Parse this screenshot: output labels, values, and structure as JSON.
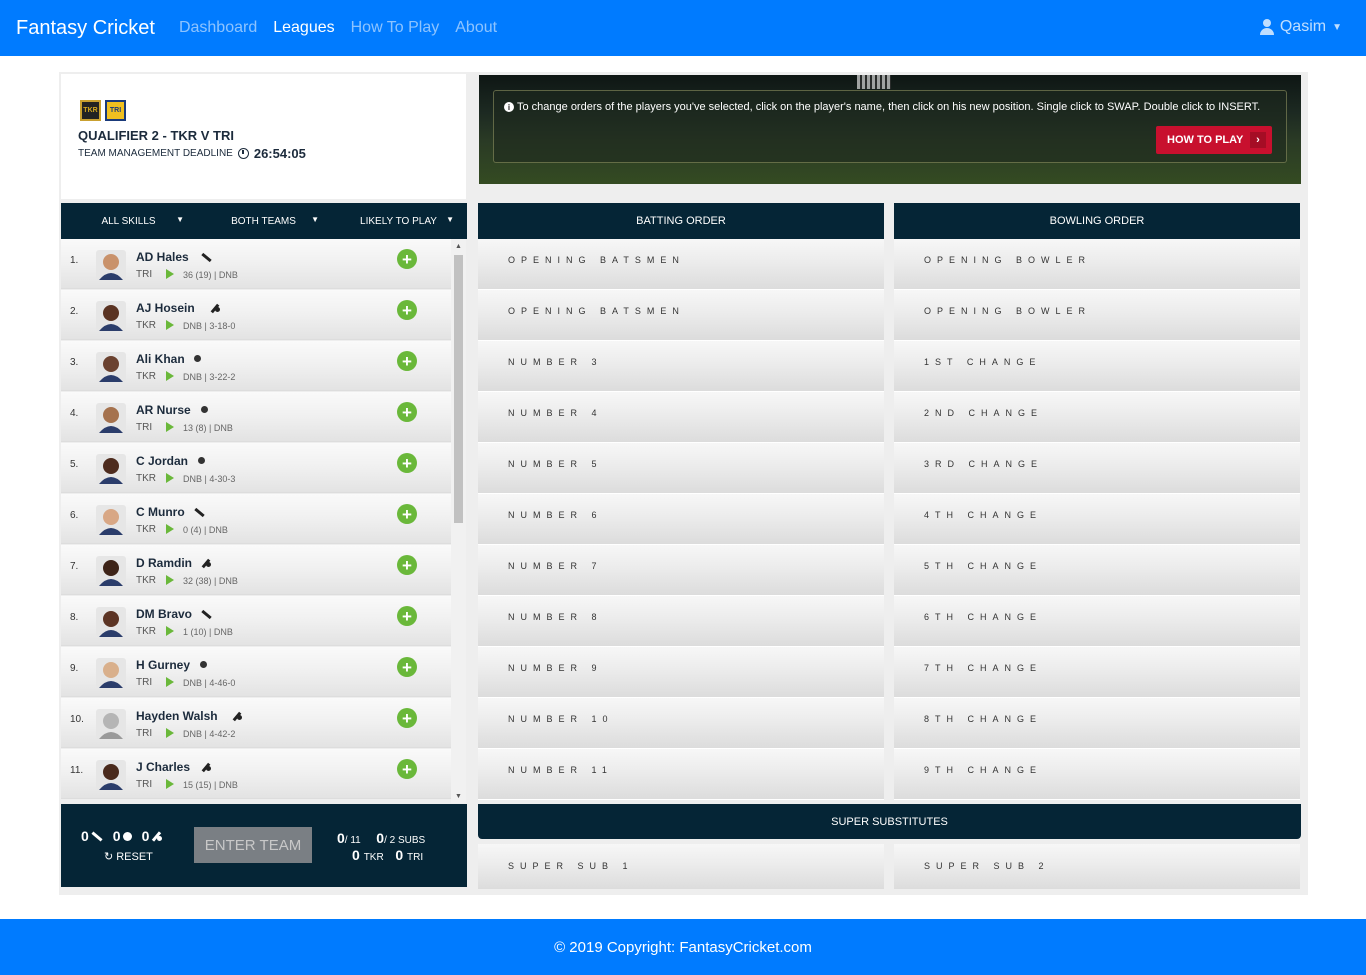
{
  "nav": {
    "brand": "Fantasy Cricket",
    "links": [
      "Dashboard",
      "Leagues",
      "How To Play",
      "About"
    ],
    "user": "Qasim"
  },
  "match": {
    "team_logos": [
      "TKR",
      "TRI"
    ],
    "title": "QUALIFIER 2 - TKR V TRI",
    "deadline_label": "TEAM MANAGEMENT DEADLINE",
    "countdown": "26:54:05"
  },
  "banner": {
    "info_text": "To change orders of the players you've selected, click on the player's name, then click on his new position. Single click to SWAP. Double click to INSERT.",
    "howto_label": "HOW TO PLAY"
  },
  "filters": [
    "ALL SKILLS",
    "BOTH TEAMS",
    "LIKELY TO PLAY"
  ],
  "players": [
    {
      "num": "1.",
      "name": "AD Hales",
      "team": "TRI",
      "stats": "36 (19) | DNB",
      "skill": "bat"
    },
    {
      "num": "2.",
      "name": "AJ Hosein",
      "team": "TKR",
      "stats": "DNB | 3-18-0",
      "skill": "allrounder"
    },
    {
      "num": "3.",
      "name": "Ali Khan",
      "team": "TKR",
      "stats": "DNB | 3-22-2",
      "skill": "ball"
    },
    {
      "num": "4.",
      "name": "AR Nurse",
      "team": "TRI",
      "stats": "13 (8) | DNB",
      "skill": "ball"
    },
    {
      "num": "5.",
      "name": "C Jordan",
      "team": "TKR",
      "stats": "DNB | 4-30-3",
      "skill": "ball"
    },
    {
      "num": "6.",
      "name": "C Munro",
      "team": "TKR",
      "stats": "0 (4) | DNB",
      "skill": "bat"
    },
    {
      "num": "7.",
      "name": "D Ramdin",
      "team": "TKR",
      "stats": "32 (38) | DNB",
      "skill": "allrounder"
    },
    {
      "num": "8.",
      "name": "DM Bravo",
      "team": "TKR",
      "stats": "1 (10) | DNB",
      "skill": "bat"
    },
    {
      "num": "9.",
      "name": "H Gurney",
      "team": "TRI",
      "stats": "DNB | 4-46-0",
      "skill": "ball"
    },
    {
      "num": "10.",
      "name": "Hayden Walsh",
      "team": "TRI",
      "stats": "DNB | 4-42-2",
      "skill": "allrounder"
    },
    {
      "num": "11.",
      "name": "J Charles",
      "team": "TRI",
      "stats": "15 (15) | DNB",
      "skill": "allrounder"
    }
  ],
  "team_bar": {
    "bat_count": "0",
    "ball_count": "0",
    "ar_count": "0",
    "reset_label": "RESET",
    "enter_label": "ENTER TEAM",
    "picked": "0",
    "picked_of": "/ 11",
    "subs": "0",
    "subs_of": "/ 2 SUBS",
    "tkr_count": "0",
    "tkr_label": "TKR",
    "tri_count": "0",
    "tri_label": "TRI"
  },
  "batting": {
    "title": "BATTING ORDER",
    "slots": [
      "OPENING BATSMEN",
      "OPENING BATSMEN",
      "NUMBER 3",
      "NUMBER 4",
      "NUMBER 5",
      "NUMBER 6",
      "NUMBER 7",
      "NUMBER 8",
      "NUMBER 9",
      "NUMBER 10",
      "NUMBER 11"
    ]
  },
  "bowling": {
    "title": "BOWLING ORDER",
    "slots": [
      "OPENING BOWLER",
      "OPENING BOWLER",
      "1ST CHANGE",
      "2ND CHANGE",
      "3RD CHANGE",
      "4TH CHANGE",
      "5TH CHANGE",
      "6TH CHANGE",
      "7TH CHANGE",
      "8TH CHANGE",
      "9TH CHANGE"
    ]
  },
  "subs": {
    "title": "SUPER SUBSTITUTES",
    "slots": [
      "SUPER SUB 1",
      "SUPER SUB 2"
    ]
  },
  "footer": "© 2019 Copyright: FantasyCricket.com"
}
